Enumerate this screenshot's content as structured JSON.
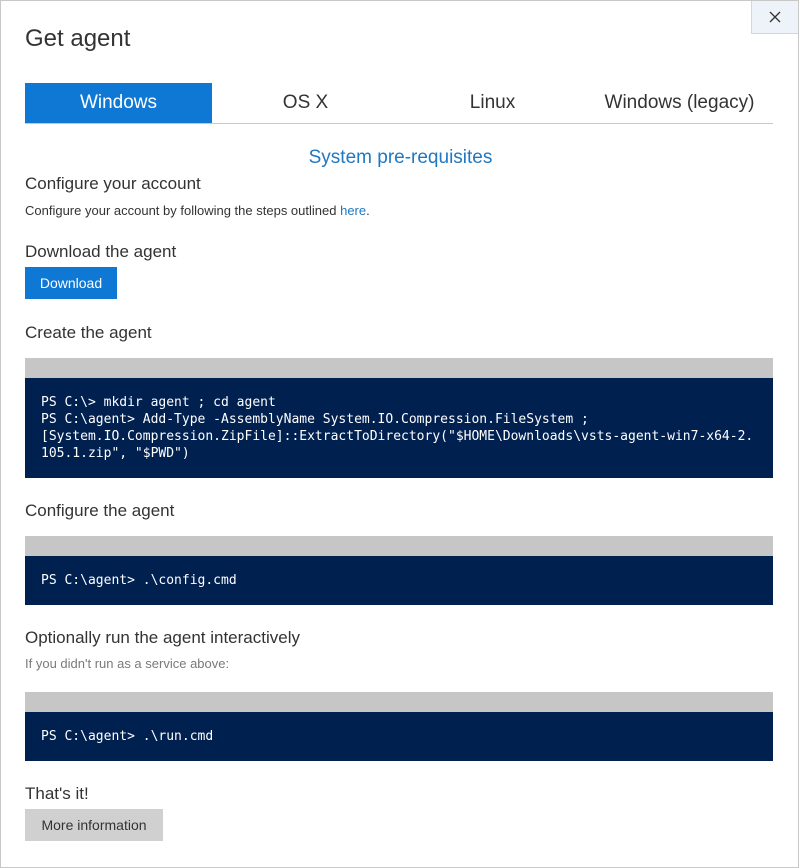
{
  "dialog": {
    "title": "Get agent",
    "close_icon": "×"
  },
  "tabs": [
    {
      "label": "Windows",
      "active": true
    },
    {
      "label": "OS X",
      "active": false
    },
    {
      "label": "Linux",
      "active": false
    },
    {
      "label": "Windows (legacy)",
      "active": false
    }
  ],
  "prereq_link": "System pre-requisites",
  "configure_account": {
    "heading": "Configure your account",
    "text": "Configure your account by following the steps outlined ",
    "link": "here",
    "suffix": "."
  },
  "download": {
    "heading": "Download the agent",
    "button": "Download"
  },
  "create": {
    "heading": "Create the agent",
    "code": "PS C:\\> mkdir agent ; cd agent\nPS C:\\agent> Add-Type -AssemblyName System.IO.Compression.FileSystem ;\n[System.IO.Compression.ZipFile]::ExtractToDirectory(\"$HOME\\Downloads\\vsts-agent-win7-x64-2.105.1.zip\", \"$PWD\")"
  },
  "configure_agent": {
    "heading": "Configure the agent",
    "code": "PS C:\\agent> .\\config.cmd"
  },
  "run_agent": {
    "heading": "Optionally run the agent interactively",
    "note": "If you didn't run as a service above:",
    "code": "PS C:\\agent> .\\run.cmd"
  },
  "done": {
    "heading": "That's it!",
    "button": "More information"
  },
  "colors": {
    "accent": "#0f78d4",
    "code_bg": "#002050",
    "link": "#1f78c1"
  }
}
